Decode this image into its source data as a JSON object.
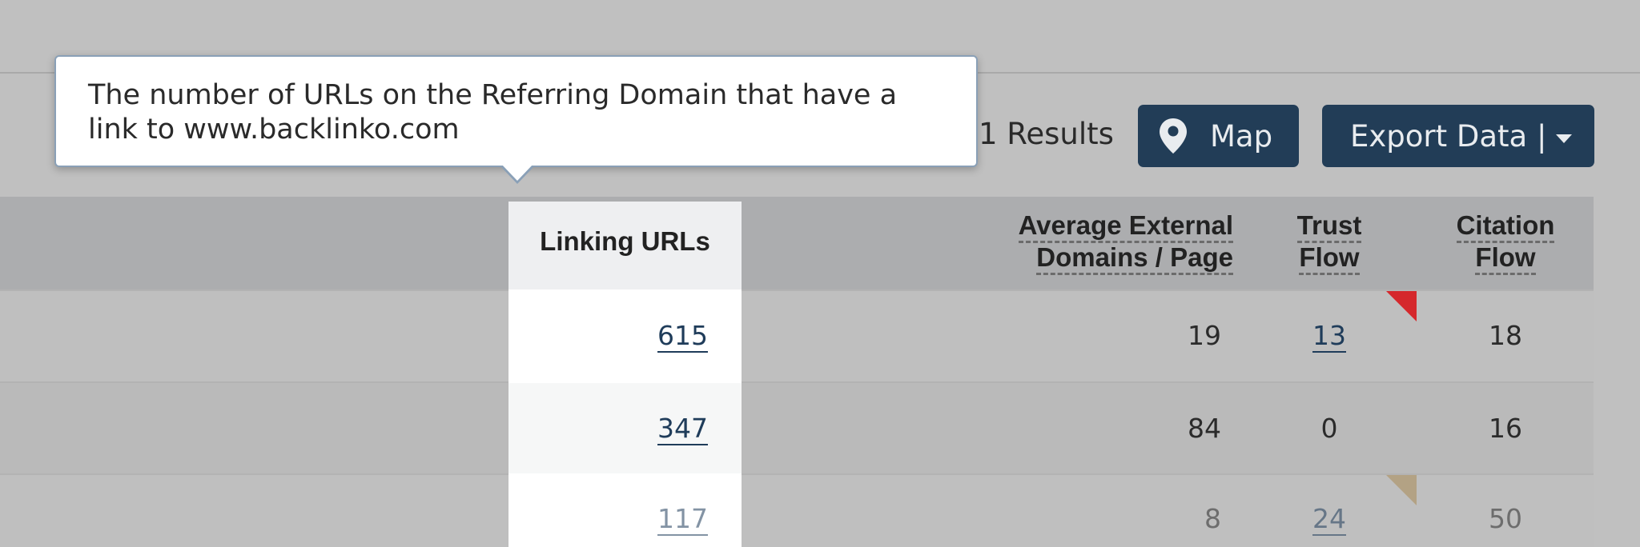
{
  "toolbar": {
    "results_text": "1 Results",
    "map_label": "Map",
    "map_icon": "map-pin-icon",
    "export_label": "Export Data |",
    "export_icon": "caret-down-icon",
    "button_color": "#223d57"
  },
  "tooltip": {
    "text": "The number of URLs on the Referring Domain that have a link to www.backlinko.com"
  },
  "table": {
    "headers": {
      "linking_urls": "Linking URLs",
      "avg_external_line1": "Average External",
      "avg_external_line2": "Domains / Page",
      "trust_line1": "Trust",
      "trust_line2": "Flow",
      "citation_line1": "Citation",
      "citation_line2": "Flow"
    },
    "rows": [
      {
        "linking_urls": "615",
        "avg_external": "19",
        "trust_flow": "13",
        "citation_flow": "18",
        "flag_color": "#d5282c"
      },
      {
        "linking_urls": "347",
        "avg_external": "84",
        "trust_flow": "0",
        "citation_flow": "16"
      },
      {
        "linking_urls": "117",
        "avg_external": "8",
        "trust_flow": "24",
        "citation_flow": "50",
        "flag_color": "#b3a284"
      }
    ]
  }
}
